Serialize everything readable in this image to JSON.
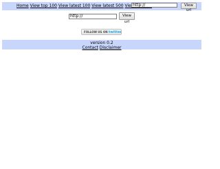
{
  "nav": {
    "items": [
      {
        "label": "Home"
      },
      {
        "label": "View top 100"
      },
      {
        "label": "View latest 100"
      },
      {
        "label": "View latest 500"
      },
      {
        "label": "View random"
      }
    ]
  },
  "top_form": {
    "url_value": "http://",
    "button_label": "View url"
  },
  "main_form": {
    "url_value": "http://",
    "button_label": "View url"
  },
  "follow_button": {
    "prefix": "FOLLOW US ON",
    "brand": "twitter"
  },
  "footer": {
    "version": "version 0.2",
    "links": [
      {
        "label": "Contact"
      },
      {
        "label": "Disclaimer"
      }
    ]
  },
  "colors": {
    "bar_background": "#c9d6fb",
    "twitter_blue": "#2fa9e0"
  }
}
